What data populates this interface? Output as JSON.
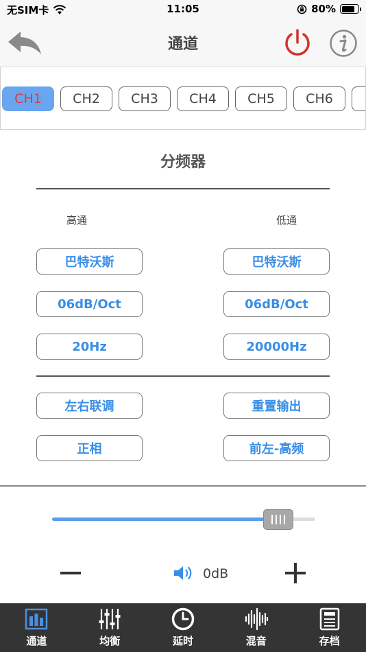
{
  "status": {
    "carrier": "无SIM卡",
    "time": "11:05",
    "battery": "80%",
    "battery_level": 0.8
  },
  "nav": {
    "title": "通道"
  },
  "channels": [
    "CH1",
    "CH2",
    "CH3",
    "CH4",
    "CH5",
    "CH6",
    "C"
  ],
  "active_channel": "CH1",
  "crossover": {
    "title": "分频器",
    "high_label": "高通",
    "low_label": "低通",
    "high_type": "巴特沃斯",
    "low_type": "巴特沃斯",
    "high_slope": "06dB/Oct",
    "low_slope": "06dB/Oct",
    "high_freq": "20Hz",
    "low_freq": "20000Hz",
    "link_mode": "左右联调",
    "reset_output": "重置输出",
    "phase": "正相",
    "output": "前左-高频"
  },
  "volume": {
    "value": "0dB",
    "level": 0.86
  },
  "tabs": [
    {
      "label": "通道",
      "icon": "channel-bars-icon"
    },
    {
      "label": "均衡",
      "icon": "equalizer-sliders-icon"
    },
    {
      "label": "延时",
      "icon": "clock-icon"
    },
    {
      "label": "混音",
      "icon": "waveform-icon"
    },
    {
      "label": "存档",
      "icon": "archive-icon"
    }
  ],
  "colors": {
    "accent": "#3a8ee6",
    "active_tab_bg": "#6aa6ef",
    "active_tab_text": "#e53935",
    "power": "#d0342c",
    "tabbar": "#343434"
  }
}
